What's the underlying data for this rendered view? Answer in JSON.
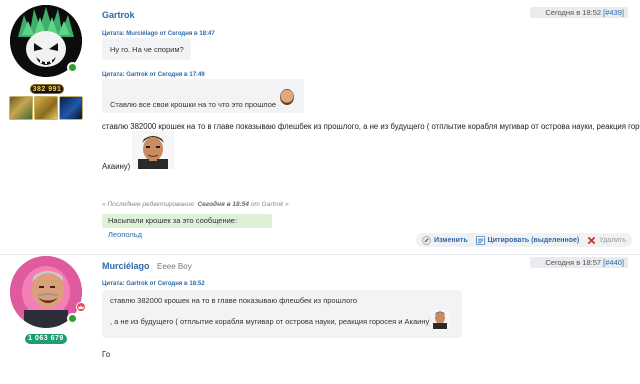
{
  "post1": {
    "author": "Gartrok",
    "date": "Сегодня в 18:52",
    "post_number": "[#439]",
    "reputation": "382 991",
    "quote1_header": "Цитата: Murciélago от Сегодня в 18:47",
    "quote1_text": "Ну го. На че спорим?",
    "quote2_header": "Цитата: Gartrok от Сегодня в 17:49",
    "quote2_text": "Ставлю все свои крошки на то что это прошлое",
    "body_line1": "ставлю 382000 крошек на то в главе показываю флешбек из прошлого, а не из будущего ( отплытие корабля мугивар от острова науки, реакция горосея и",
    "body_line2": "Акаину)",
    "edited_prefix": "« Последнее редактирование:",
    "edited_time": "Сегодня в 18:54",
    "edited_suffix": "от Gartrok »",
    "thanks_prefix": "Насыпали крошек за это сообщение:",
    "thanks_user": "Леопольд",
    "actions": {
      "edit": "Изменить",
      "quote": "Цитировать (выделенное)",
      "delete": "Удалить"
    }
  },
  "post2": {
    "author": "Murciélago",
    "author_title": "Eeee Boy",
    "date": "Сегодня в 18:57",
    "post_number": "[#440]",
    "reputation": "1 063 679",
    "quote_header": "Цитата: Gartrok от Сегодня в 18:52",
    "quote_line1": "ставлю 382000 крошек на то в главе показываю флешбек из прошлого",
    "quote_line2": ", а не из будущего ( отплытие корабля мугивар от острова науки, реакция горосея и Акаину)",
    "body": "Го"
  },
  "colors": {
    "link": "#2f6aa8",
    "online": "#2ea02e",
    "thanks_bg": "#dff0d8",
    "rep_green": "#1f9e72"
  }
}
